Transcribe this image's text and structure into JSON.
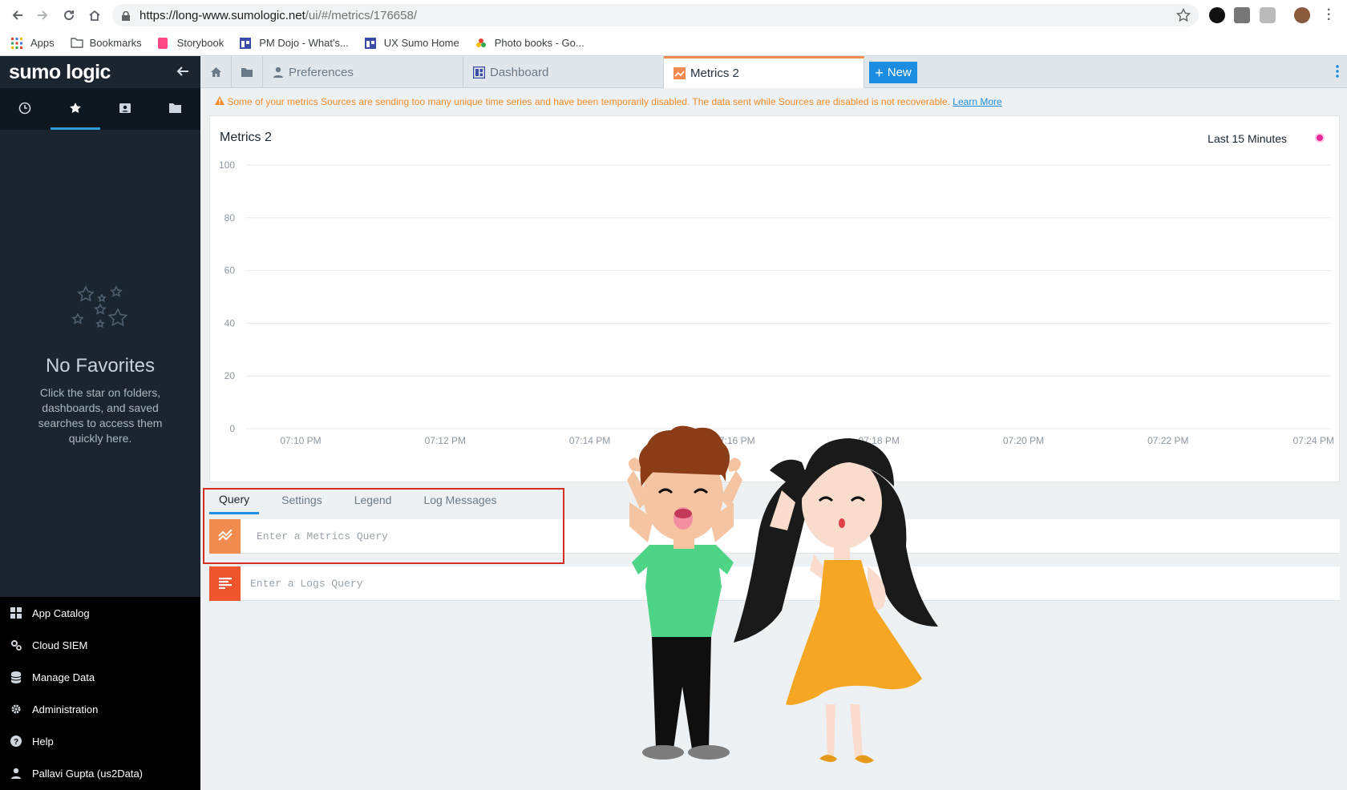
{
  "browser": {
    "url_host": "https://long-www.sumologic.net",
    "url_path": "/ui/#/metrics/176658/",
    "bookmarks": [
      "Apps",
      "Bookmarks",
      "Storybook",
      "PM Dojo - What's...",
      "UX Sumo Home",
      "Photo books - Go..."
    ]
  },
  "sidebar": {
    "logo": "sumo logic",
    "empty_title": "No Favorites",
    "empty_text": "Click the star on folders, dashboards, and saved searches to access them quickly here.",
    "links": [
      {
        "label": "App Catalog",
        "icon": "grid-icon"
      },
      {
        "label": "Cloud SIEM",
        "icon": "gears-icon"
      },
      {
        "label": "Manage Data",
        "icon": "database-icon"
      },
      {
        "label": "Administration",
        "icon": "gear-icon"
      },
      {
        "label": "Help",
        "icon": "help-icon"
      },
      {
        "label": "Pallavi Gupta (us2Data)",
        "icon": "user-icon"
      }
    ]
  },
  "tabs": {
    "preferences": "Preferences",
    "dashboard": "Dashboard",
    "metrics": "Metrics 2",
    "new": "New"
  },
  "warning": {
    "text": "Some of your metrics Sources are sending too many unique time series and have been temporarily disabled. The data sent while Sources are disabled is not recoverable.",
    "link": "Learn More"
  },
  "panel": {
    "title": "Metrics 2",
    "time_range": "Last 15 Minutes"
  },
  "chart_data": {
    "type": "line",
    "title": "Metrics 2",
    "x": [
      "07:10 PM",
      "07:12 PM",
      "07:14 PM",
      "07:16 PM",
      "07:18 PM",
      "07:20 PM",
      "07:22 PM",
      "07:24 PM"
    ],
    "yticks": [
      0,
      20,
      40,
      60,
      80,
      100
    ],
    "ylim": [
      0,
      100
    ],
    "series": [],
    "grid": true
  },
  "query_tabs": [
    "Query",
    "Settings",
    "Legend",
    "Log Messages"
  ],
  "metrics_query_placeholder": "Enter a Metrics Query",
  "logs_query_placeholder": "Enter a Logs Query",
  "colors": {
    "accent": "#1c8de0",
    "metrics": "#f28b50",
    "logs": "#f0562e",
    "highlight": "#d32f22"
  }
}
